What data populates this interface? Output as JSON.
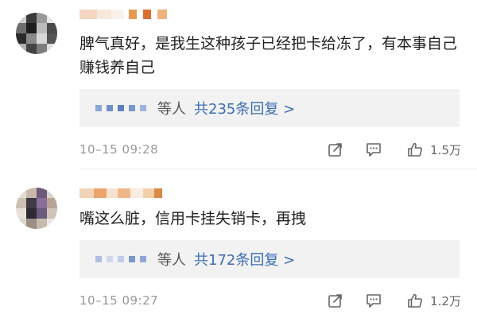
{
  "comments": [
    {
      "text": "脾气真好，是我生这种孩子已经把卡给冻了，有本事自己赚钱养自己",
      "replies_who": "等人",
      "replies_more": "共235条回复 >",
      "time": "10–15 09:28",
      "likes": "1.5万"
    },
    {
      "text": "嘴这么脏，信用卡挂失销卡，再拽",
      "replies_who": "等人",
      "replies_more": "共172条回复 >",
      "time": "10–15 09:27",
      "likes": "1.2万"
    }
  ],
  "colors": {
    "reply_link": "#3b6db5",
    "reply_bg": "#f2f2f2",
    "meta": "#999999"
  },
  "icons": [
    "share-icon",
    "comment-icon",
    "thumbs-up-icon"
  ]
}
